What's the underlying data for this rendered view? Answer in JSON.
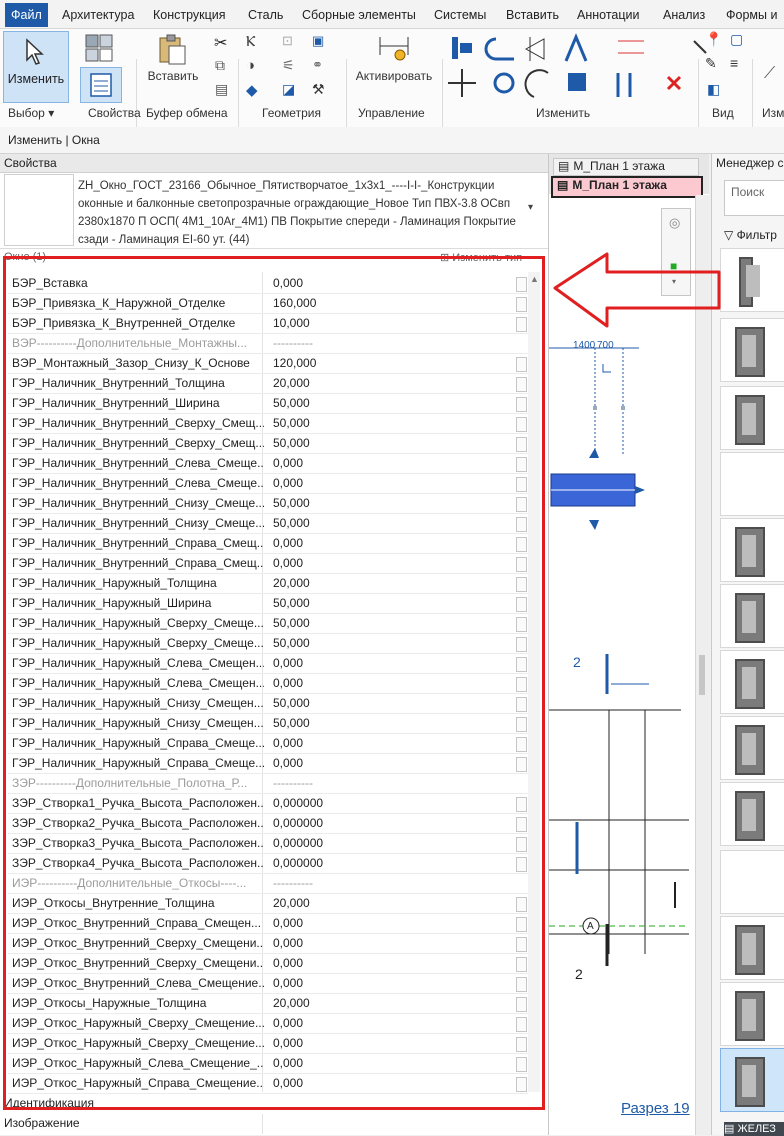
{
  "menu": {
    "tabs": [
      "Файл",
      "Архитектура",
      "Конструкция",
      "Сталь",
      "Сборные элементы",
      "Системы",
      "Вставить",
      "Аннотации",
      "Анализ",
      "Формы и"
    ],
    "active_index": 0
  },
  "ribbon": {
    "modify_label": "Изменить",
    "paste_label": "Вставить",
    "activate_label": "Активировать",
    "panels": {
      "select": "Выбор",
      "properties": "Свойства",
      "clipboard": "Буфер обмена",
      "geometry": "Геометрия",
      "control": "Управление",
      "modify": "Изменить",
      "view": "Вид",
      "measure": "Изм"
    }
  },
  "context_bar": "Изменить | Окна",
  "properties": {
    "header": "Свойства",
    "type_name": "ZH_Окно_ГОСТ_23166_Обычное_Пятистворчатое_1x3x1_----I-I-_Конструкции оконные и балконные светопрозрачные ограждающие_Новое Тип ПВХ-3.8 ОСвп 2380x1870 П ОСП( 4М1_10Ar_4М1) ПВ Покрытие спереди - Ламинация Покрытие сзади - Ламинация EI-60 ут. (44)",
    "instance_filter": "Окно (1)",
    "edit_type": "Изменить тип",
    "rows": [
      {
        "name": "БЭР_Вставка",
        "value": "0,000",
        "group": false
      },
      {
        "name": "БЭР_Привязка_К_Наружной_Отделке",
        "value": "160,000",
        "group": false
      },
      {
        "name": "БЭР_Привязка_К_Внутренней_Отделке",
        "value": "10,000",
        "group": false
      },
      {
        "name": "ВЭР----------Дополнительные_Монтажны...",
        "value": "----------",
        "group": true
      },
      {
        "name": "ВЭР_Монтажный_Зазор_Снизу_К_Основе",
        "value": "120,000",
        "group": false
      },
      {
        "name": "ГЭР_Наличник_Внутренний_Толщина",
        "value": "20,000",
        "group": false
      },
      {
        "name": "ГЭР_Наличник_Внутренний_Ширина",
        "value": "50,000",
        "group": false
      },
      {
        "name": "ГЭР_Наличник_Внутренний_Сверху_Смещ...",
        "value": "50,000",
        "group": false
      },
      {
        "name": "ГЭР_Наличник_Внутренний_Сверху_Смещ...",
        "value": "50,000",
        "group": false
      },
      {
        "name": "ГЭР_Наличник_Внутренний_Слева_Смеще...",
        "value": "0,000",
        "group": false
      },
      {
        "name": "ГЭР_Наличник_Внутренний_Слева_Смеще...",
        "value": "0,000",
        "group": false
      },
      {
        "name": "ГЭР_Наличник_Внутренний_Снизу_Смеще...",
        "value": "50,000",
        "group": false
      },
      {
        "name": "ГЭР_Наличник_Внутренний_Снизу_Смеще...",
        "value": "50,000",
        "group": false
      },
      {
        "name": "ГЭР_Наличник_Внутренний_Справа_Смещ...",
        "value": "0,000",
        "group": false
      },
      {
        "name": "ГЭР_Наличник_Внутренний_Справа_Смещ...",
        "value": "0,000",
        "group": false
      },
      {
        "name": "ГЭР_Наличник_Наружный_Толщина",
        "value": "20,000",
        "group": false
      },
      {
        "name": "ГЭР_Наличник_Наружный_Ширина",
        "value": "50,000",
        "group": false
      },
      {
        "name": "ГЭР_Наличник_Наружный_Сверху_Смеще...",
        "value": "50,000",
        "group": false
      },
      {
        "name": "ГЭР_Наличник_Наружный_Сверху_Смеще...",
        "value": "50,000",
        "group": false
      },
      {
        "name": "ГЭР_Наличник_Наружный_Слева_Смещен...",
        "value": "0,000",
        "group": false
      },
      {
        "name": "ГЭР_Наличник_Наружный_Слева_Смещен...",
        "value": "0,000",
        "group": false
      },
      {
        "name": "ГЭР_Наличник_Наружный_Снизу_Смещен...",
        "value": "50,000",
        "group": false
      },
      {
        "name": "ГЭР_Наличник_Наружный_Снизу_Смещен...",
        "value": "50,000",
        "group": false
      },
      {
        "name": "ГЭР_Наличник_Наружный_Справа_Смеще...",
        "value": "0,000",
        "group": false
      },
      {
        "name": "ГЭР_Наличник_Наружный_Справа_Смеще...",
        "value": "0,000",
        "group": false
      },
      {
        "name": "ЗЭР----------Дополнительные_Полотна_Р...",
        "value": "----------",
        "group": true
      },
      {
        "name": "ЗЭР_Створка1_Ручка_Высота_Расположен...",
        "value": "0,000000",
        "group": false
      },
      {
        "name": "ЗЭР_Створка2_Ручка_Высота_Расположен...",
        "value": "0,000000",
        "group": false
      },
      {
        "name": "ЗЭР_Створка3_Ручка_Высота_Расположен...",
        "value": "0,000000",
        "group": false
      },
      {
        "name": "ЗЭР_Створка4_Ручка_Высота_Расположен...",
        "value": "0,000000",
        "group": false
      },
      {
        "name": "ИЭР----------Дополнительные_Откосы----...",
        "value": "----------",
        "group": true
      },
      {
        "name": "ИЭР_Откосы_Внутренние_Толщина",
        "value": "20,000",
        "group": false
      },
      {
        "name": "ИЭР_Откос_Внутренний_Справа_Смещен...",
        "value": "0,000",
        "group": false
      },
      {
        "name": "ИЭР_Откос_Внутренний_Сверху_Смещени...",
        "value": "0,000",
        "group": false
      },
      {
        "name": "ИЭР_Откос_Внутренний_Сверху_Смещени...",
        "value": "0,000",
        "group": false
      },
      {
        "name": "ИЭР_Откос_Внутренний_Слева_Смещение...",
        "value": "0,000",
        "group": false
      },
      {
        "name": "ИЭР_Откосы_Наружные_Толщина",
        "value": "20,000",
        "group": false
      },
      {
        "name": "ИЭР_Откос_Наружный_Сверху_Смещение...",
        "value": "0,000",
        "group": false
      },
      {
        "name": "ИЭР_Откос_Наружный_Сверху_Смещение...",
        "value": "0,000",
        "group": false
      },
      {
        "name": "ИЭР_Откос_Наружный_Слева_Смещение_...",
        "value": "0,000",
        "group": false
      },
      {
        "name": "ИЭР_Откос_Наружный_Справа_Смещение...",
        "value": "0,000",
        "group": false
      }
    ],
    "footer_group": "Идентификация",
    "footer_row": "Изображение"
  },
  "view_tabs": [
    "М_План 1 этажа",
    "М_План 1 этажа"
  ],
  "drawing": {
    "dim_1400": "1400",
    "dim_700": "700",
    "mark_2a": "2",
    "mark_2b": "2",
    "axis_a": "A",
    "section_link": "Разрез 19"
  },
  "manager": {
    "title": "Менеджер с",
    "search_placeholder": "Поиск",
    "filter_label": "Фильтр",
    "bottom_label": "ЖЕЛЕЗ"
  },
  "colors": {
    "accent": "#1e5aa8",
    "highlight": "#e02020",
    "selected": "#3a66d8"
  }
}
